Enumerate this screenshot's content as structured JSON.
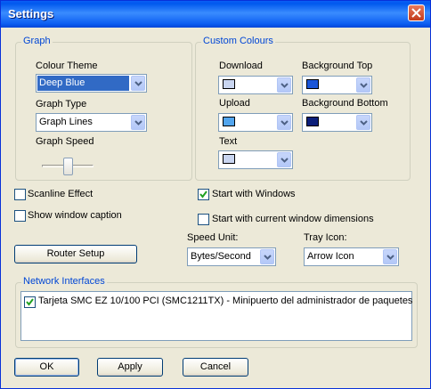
{
  "window": {
    "title": "Settings"
  },
  "graph": {
    "legend": "Graph",
    "colour_theme_label": "Colour Theme",
    "colour_theme_value": "Deep Blue",
    "graph_type_label": "Graph Type",
    "graph_type_value": "Graph Lines",
    "graph_speed_label": "Graph Speed",
    "graph_speed_level": 0.5
  },
  "custom_colours": {
    "legend": "Custom Colours",
    "download_label": "Download",
    "download_color": "#c9d5f0",
    "upload_label": "Upload",
    "upload_color": "#52a5ee",
    "text_label": "Text",
    "text_color": "#c9d5f0",
    "background_top_label": "Background Top",
    "background_top_color": "#1b56d8",
    "background_bottom_label": "Background Bottom",
    "background_bottom_color": "#0c1f7a"
  },
  "options": {
    "scanline_effect": {
      "label": "Scanline Effect",
      "checked": false
    },
    "show_window_caption": {
      "label": "Show window caption",
      "checked": false
    },
    "start_with_windows": {
      "label": "Start with Windows",
      "checked": true
    },
    "start_with_dimensions": {
      "label": "Start with current window dimensions",
      "checked": false
    }
  },
  "router_setup_label": "Router Setup",
  "speed_unit": {
    "label": "Speed Unit:",
    "value": "Bytes/Second"
  },
  "tray_icon": {
    "label": "Tray Icon:",
    "value": "Arrow Icon"
  },
  "network_interfaces": {
    "legend": "Network Interfaces",
    "items": [
      {
        "label": "Tarjeta SMC EZ 10/100 PCI (SMC1211TX) - Minipuerto del administrador de paquetes",
        "checked": true
      }
    ]
  },
  "buttons": {
    "ok": "OK",
    "apply": "Apply",
    "cancel": "Cancel"
  }
}
